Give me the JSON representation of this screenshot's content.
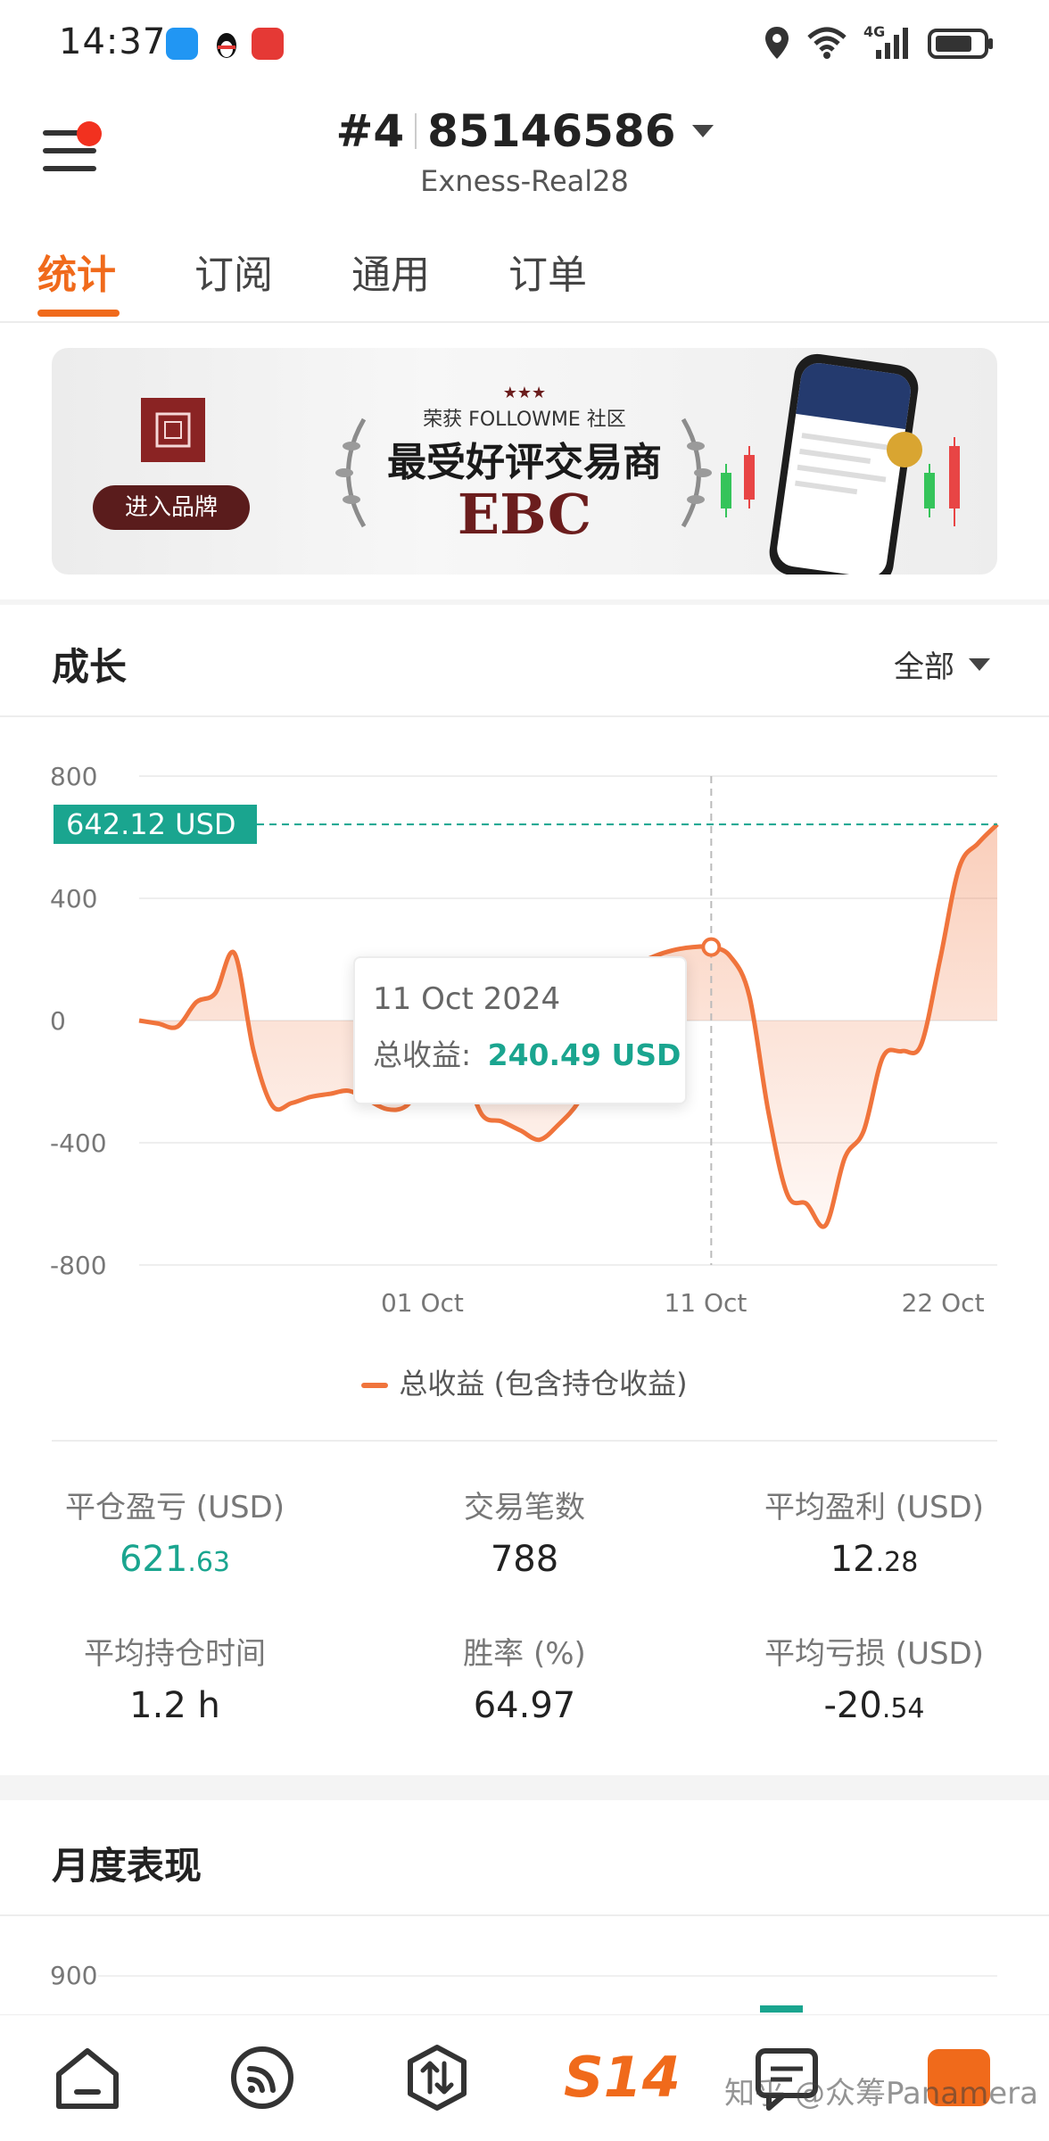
{
  "status_bar": {
    "time": "14:37",
    "network": "4G",
    "icons": [
      "message-app-icon",
      "penguin-app-icon",
      "red-app-icon",
      "location-icon",
      "wifi-icon",
      "signal-icon",
      "battery-icon"
    ]
  },
  "header": {
    "rank": "#4",
    "account_number": "85146586",
    "server": "Exness-Real28"
  },
  "tabs": [
    {
      "label": "统计",
      "active": true
    },
    {
      "label": "订阅",
      "active": false
    },
    {
      "label": "通用",
      "active": false
    },
    {
      "label": "订单",
      "active": false
    }
  ],
  "banner": {
    "subtitle": "荣获 FOLLOWME 社区",
    "title": "最受好评交易商",
    "brand": "EBC",
    "button": "进入品牌"
  },
  "growth": {
    "title": "成长",
    "filter": "全部",
    "tooltip_date": "11 Oct 2024",
    "tooltip_label": "总收益:",
    "tooltip_value": "240.49 USD",
    "current_label": "642.12 USD",
    "legend": "总收益 (包含持仓收益)"
  },
  "chart_data": {
    "type": "area",
    "series": [
      {
        "name": "总收益 (包含持仓收益)",
        "color": "#f0743c",
        "values": [
          0,
          -10,
          -20,
          60,
          90,
          220,
          -100,
          -280,
          -270,
          -250,
          -240,
          -230,
          -260,
          -290,
          -280,
          -200,
          -150,
          -170,
          -310,
          -330,
          -360,
          -390,
          -340,
          -270,
          -150,
          140,
          180,
          210,
          230,
          240,
          240,
          210,
          80,
          -300,
          -570,
          -600,
          -670,
          -450,
          -360,
          -120,
          -100,
          -80,
          200,
          500,
          580,
          642.12
        ]
      }
    ],
    "x_ticks": [
      "01 Oct",
      "11 Oct",
      "22 Oct"
    ],
    "y_ticks": [
      "800",
      "400",
      "0",
      "-400",
      "-800"
    ],
    "ylim": [
      -800,
      800
    ],
    "current_value": 642.12,
    "highlight_index": 30,
    "highlight_value": 240.49,
    "grid": true,
    "legend_position": "bottom"
  },
  "stats": [
    {
      "label": "平仓盈亏 (USD)",
      "int": "621",
      "dec": ".63",
      "green": true
    },
    {
      "label": "交易笔数",
      "int": "788",
      "dec": "",
      "green": false
    },
    {
      "label": "平均盈利 (USD)",
      "int": "12",
      "dec": ".28",
      "green": false
    },
    {
      "label": "平均持仓时间",
      "int": "1.2 h",
      "dec": "",
      "green": false
    },
    {
      "label": "胜率 (%)",
      "int": "64.97",
      "dec": "",
      "green": false
    },
    {
      "label": "平均亏损 (USD)",
      "int": "-20",
      "dec": ".54",
      "green": false
    }
  ],
  "monthly": {
    "title": "月度表现",
    "y_tick": "900"
  },
  "bottom_nav": {
    "s14": "S14",
    "watermark": "知乎 @众筹Panamera",
    "icons": [
      "home-icon",
      "feed-icon",
      "trade-icon",
      "s14-icon",
      "message-icon",
      "profile-icon"
    ]
  },
  "colors": {
    "accent": "#f06a1b",
    "green": "#1aa58f",
    "line": "#f0743c"
  }
}
